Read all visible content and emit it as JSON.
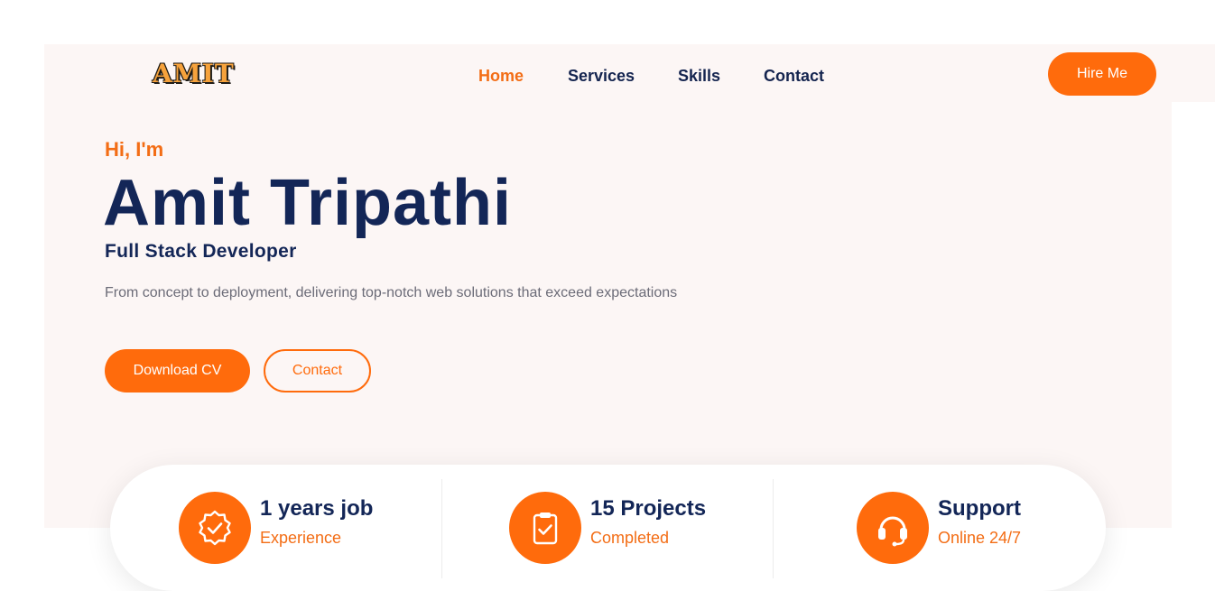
{
  "logo": {
    "text": "AMIT"
  },
  "nav": {
    "items": [
      {
        "label": "Home",
        "active": true
      },
      {
        "label": "Services",
        "active": false
      },
      {
        "label": "Skills",
        "active": false
      },
      {
        "label": "Contact",
        "active": false
      }
    ],
    "hire_label": "Hire Me"
  },
  "hero": {
    "greeting": "Hi, I'm",
    "name": "Amit Tripathi",
    "role": "Full Stack Developer",
    "description": "From concept to deployment, delivering top-notch web solutions that exceed expectations",
    "download_label": "Download CV",
    "contact_label": "Contact"
  },
  "stats": [
    {
      "icon": "badge-check-icon",
      "title": "1 years job",
      "subtitle": "Experience"
    },
    {
      "icon": "clipboard-check-icon",
      "title": "15 Projects",
      "subtitle": "Completed"
    },
    {
      "icon": "headset-icon",
      "title": "Support",
      "subtitle": "Online 24/7"
    }
  ],
  "colors": {
    "accent": "#ff6b0c",
    "heading": "#132657",
    "hero_bg": "#fcf6f5",
    "body_text": "#6c6c78"
  }
}
